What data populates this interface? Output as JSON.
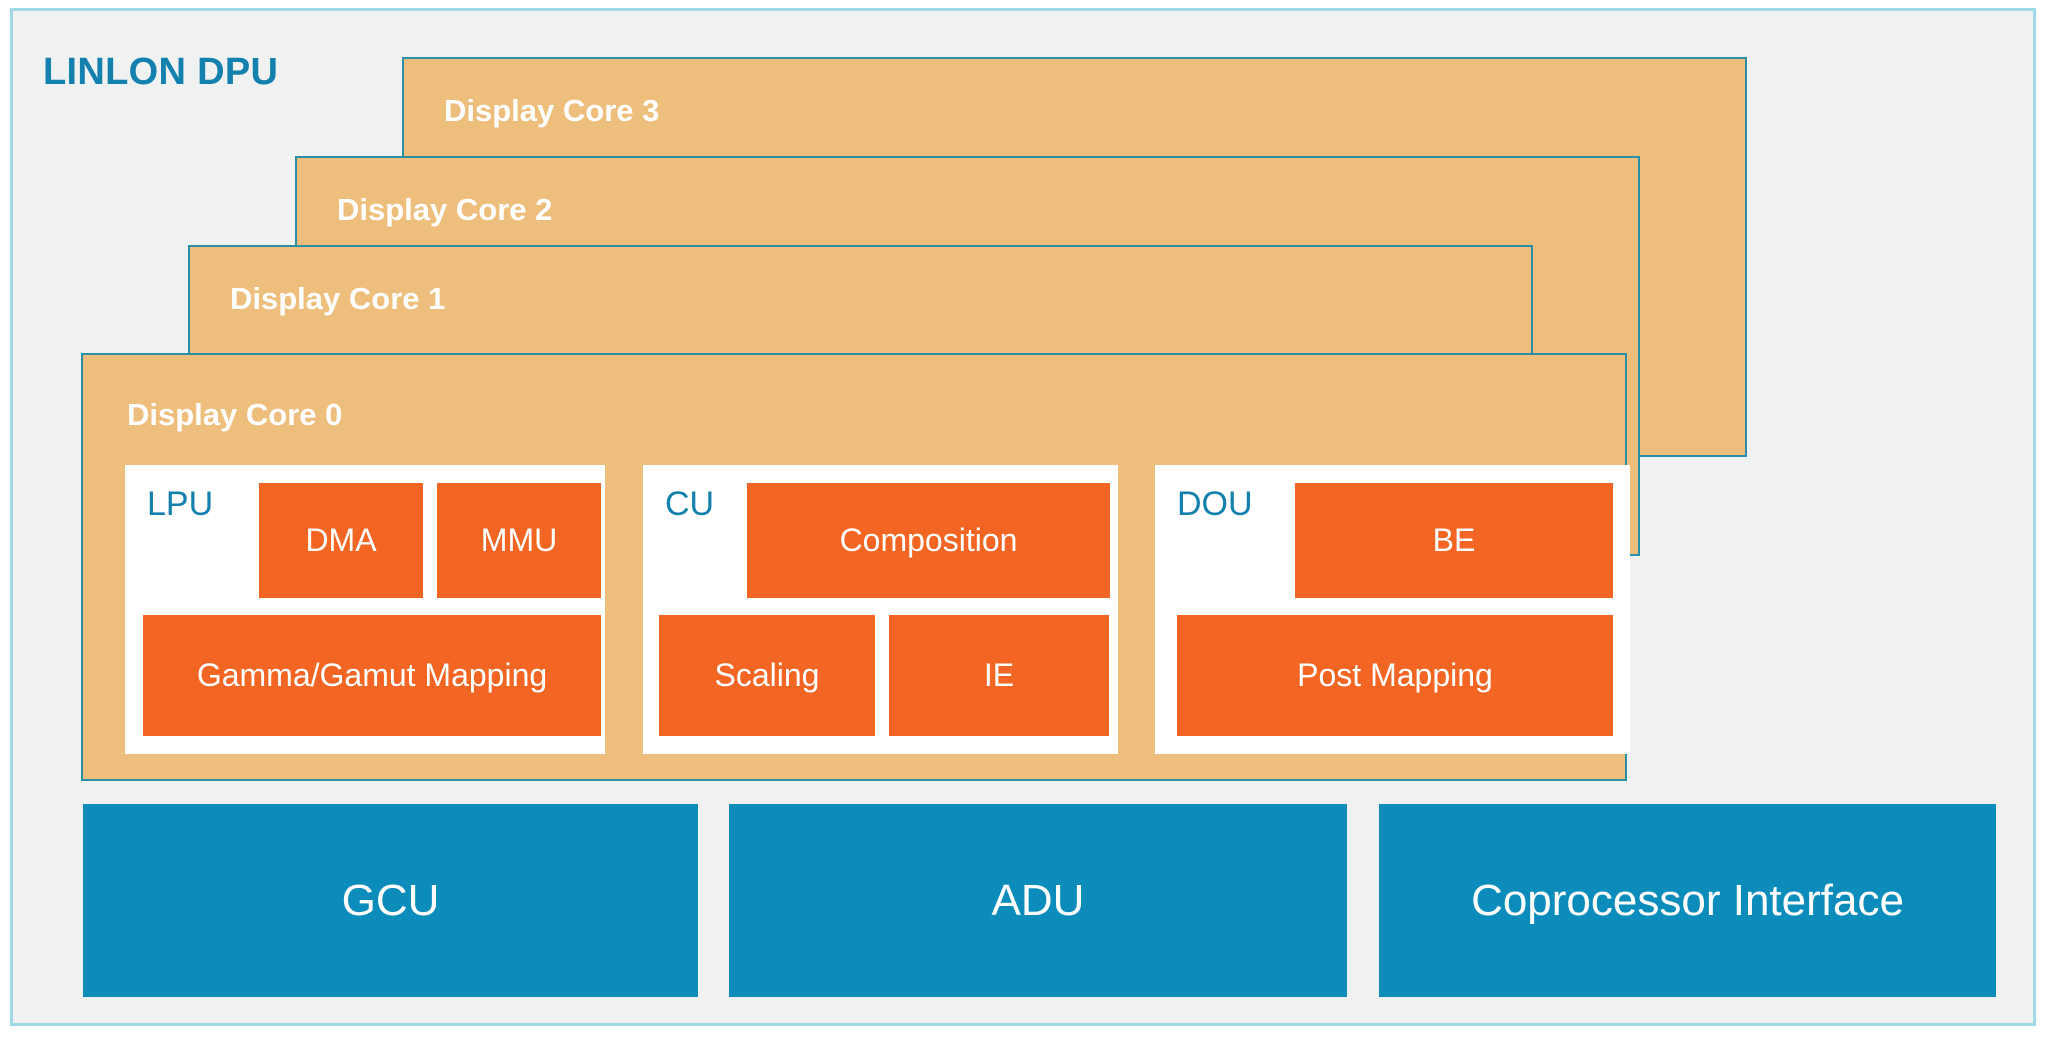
{
  "diagram": {
    "title": "LINLON DPU",
    "accent_blue": "#1380ad",
    "card_fill": "#edbe7c",
    "card_border": "#2b8fa8",
    "block_fill": "#f26522",
    "bar_fill": "#0b8cba",
    "frame_fill": "#f0f1f1",
    "frame_border": "#9fd9e8"
  },
  "cores": [
    {
      "label": "Display Core 3"
    },
    {
      "label": "Display Core 2"
    },
    {
      "label": "Display Core 1"
    },
    {
      "label": "Display Core 0"
    }
  ],
  "core0_units": {
    "lpu": {
      "title": "LPU",
      "blocks": [
        {
          "label": "DMA"
        },
        {
          "label": "MMU"
        },
        {
          "label": "Gamma/Gamut Mapping"
        }
      ]
    },
    "cu": {
      "title": "CU",
      "blocks": [
        {
          "label": "Composition"
        },
        {
          "label": "Scaling"
        },
        {
          "label": "IE"
        }
      ]
    },
    "dou": {
      "title": "DOU",
      "blocks": [
        {
          "label": "BE"
        },
        {
          "label": "Post Mapping"
        }
      ]
    }
  },
  "bottom_bars": [
    {
      "label": "GCU"
    },
    {
      "label": "ADU"
    },
    {
      "label": "Coprocessor Interface"
    }
  ]
}
